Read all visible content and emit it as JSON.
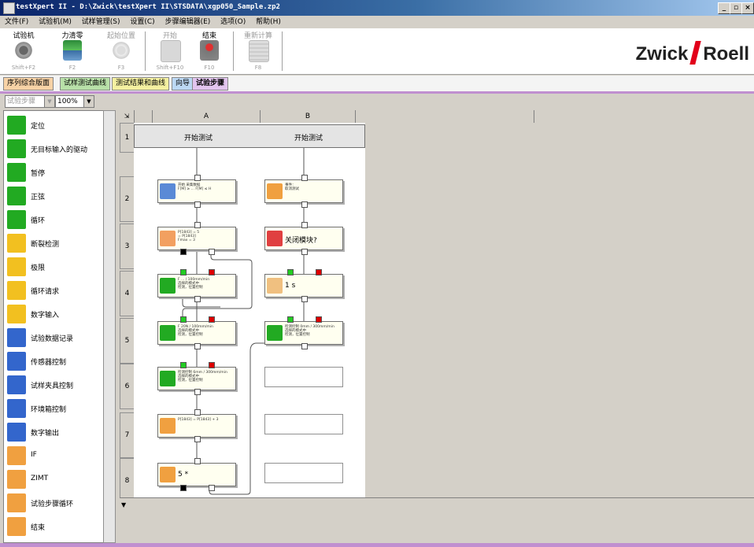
{
  "window": {
    "title": "testXpert II  - D:\\Zwick\\testXpert II\\STSDATA\\xgp050_Sample.zp2",
    "buttons": [
      "_",
      "▫",
      "×"
    ]
  },
  "menu": [
    "文件(F)",
    "试验机(M)",
    "试样管理(S)",
    "设置(C)",
    "步骤编辑器(E)",
    "选项(O)",
    "帮助(H)"
  ],
  "toolbar": [
    {
      "label": "试验机",
      "shortcut": "Shift+F2",
      "enabled": true,
      "icon": "gear-icon"
    },
    {
      "label": "力清零",
      "shortcut": "F2",
      "enabled": true,
      "icon": "force-zero-icon"
    },
    {
      "label": "起始位置",
      "shortcut": "F3",
      "enabled": false,
      "icon": "gear-icon"
    },
    {
      "label": "开始",
      "shortcut": "Shift+F10",
      "enabled": false,
      "icon": "start-icon"
    },
    {
      "label": "结束",
      "shortcut": "F10",
      "enabled": true,
      "icon": "stop-icon"
    },
    {
      "label": "重新计算",
      "shortcut": "F8",
      "enabled": false,
      "icon": "calculator-icon"
    }
  ],
  "logo": {
    "left": "Zwick",
    "right": "Roell"
  },
  "tabs": [
    "序列综合版面",
    "试样测试曲线",
    "测试结果和曲线",
    "向导",
    "试验步骤"
  ],
  "combos": {
    "step_type": "试验步骤",
    "zoom": "100%"
  },
  "palette": [
    {
      "label": "定位",
      "icon": "ramp-icon",
      "color": "#22aa22"
    },
    {
      "label": "无目标输入的驱动",
      "icon": "drive-icon",
      "color": "#22aa22"
    },
    {
      "label": "暂停",
      "icon": "hold-icon",
      "color": "#22aa22"
    },
    {
      "label": "正弦",
      "icon": "sine-icon",
      "color": "#22aa22"
    },
    {
      "label": "循环",
      "icon": "cycle-icon",
      "color": "#22aa22"
    },
    {
      "label": "断裂检测",
      "icon": "break-detect-icon",
      "color": "#f2c020"
    },
    {
      "label": "极限",
      "icon": "limit-icon",
      "color": "#f2c020"
    },
    {
      "label": "循环请求",
      "icon": "cycle-request-icon",
      "color": "#f2c020"
    },
    {
      "label": "数字输入",
      "icon": "digital-input-icon",
      "color": "#f2c020"
    },
    {
      "label": "试验数据记录",
      "icon": "data-record-icon",
      "color": "#3366cc"
    },
    {
      "label": "传感器控制",
      "icon": "sensor-icon",
      "color": "#3366cc"
    },
    {
      "label": "试样夹具控制",
      "icon": "grip-icon",
      "color": "#3366cc"
    },
    {
      "label": "环境箱控制",
      "icon": "thermometer-icon",
      "color": "#3366cc"
    },
    {
      "label": "数字输出",
      "icon": "digital-output-icon",
      "color": "#3366cc"
    },
    {
      "label": "IF",
      "icon": "question-icon",
      "color": "#f0a040"
    },
    {
      "label": "ZIMT",
      "icon": "zimt-icon",
      "color": "#f0a040"
    },
    {
      "label": "试验步骤循环",
      "icon": "loop-icon",
      "color": "#f0a040"
    },
    {
      "label": "结束",
      "icon": "stop-sign-icon",
      "color": "#f0a040"
    }
  ],
  "grid": {
    "columns": [
      "A",
      "B"
    ],
    "rows": [
      "1",
      "2",
      "3",
      "4",
      "5",
      "6",
      "7",
      "8"
    ],
    "start_label": "开始测试"
  },
  "nodes": {
    "a2": {
      "text": "开始 采集数据\nF[M] ≥ ... F[M] ≤ H"
    },
    "a3": {
      "text": "P[1843] = 5\n= P[1843]\nFmax = 3"
    },
    "a4": {
      "text": "F ... / 100mm/min\n选择的模式中\n检测，位置控制"
    },
    "a5": {
      "text": "F 20N / 100mm/min\n选择的模式中\n检测，位置控制"
    },
    "a6": {
      "text": "检测控制 6mm / 300mm/min\n选择的模式中\n检测，位置控制"
    },
    "a7": {
      "text": "P[1843] = P[1843] + 3"
    },
    "a8": {
      "text": "5 *"
    },
    "b2": {
      "text": "事件：\n取消测试"
    },
    "b3": {
      "text": "关闭模块?"
    },
    "b4": {
      "text": "1 s"
    },
    "b5": {
      "text": "检测控制 0mm / 300mm/min\n选择的模式中\n检测，位置控制"
    }
  }
}
